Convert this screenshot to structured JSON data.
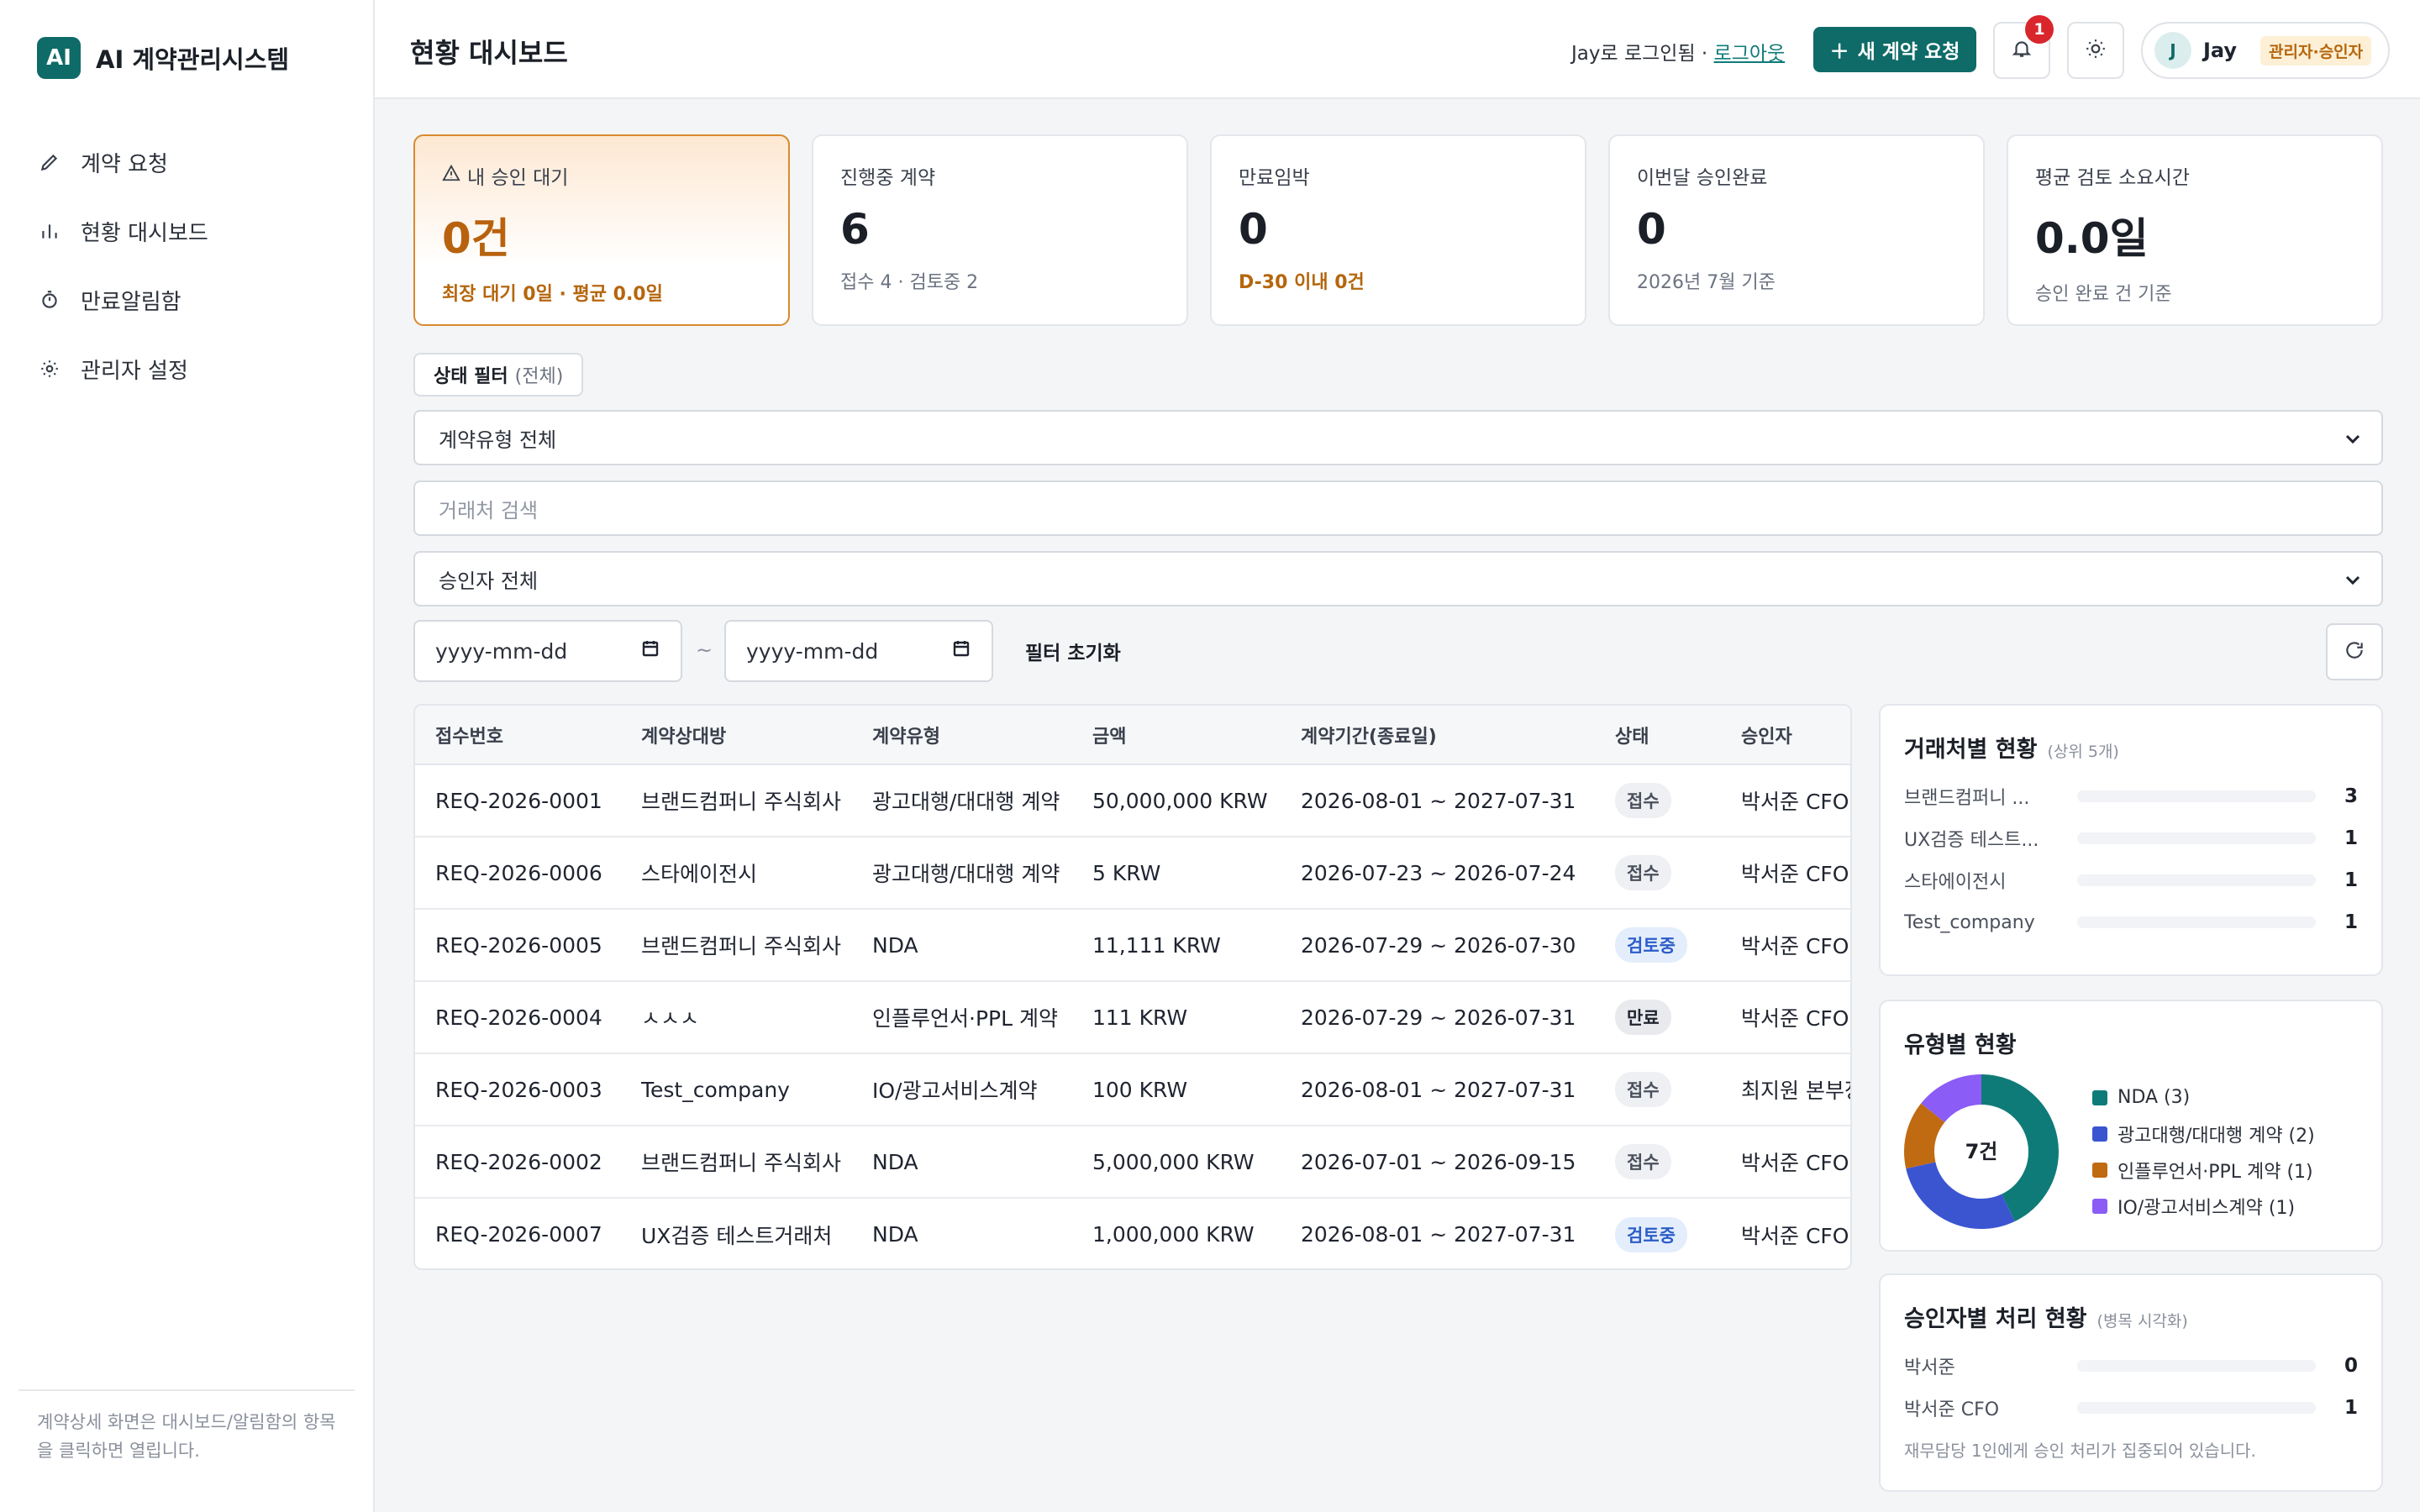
{
  "brand": {
    "logo": "AI",
    "name": "AI 계약관리시스템"
  },
  "nav": [
    {
      "label": "계약 요청",
      "icon": "pencil-icon"
    },
    {
      "label": "현황 대시보드",
      "icon": "bar-chart-icon"
    },
    {
      "label": "만료알림함",
      "icon": "stopwatch-icon"
    },
    {
      "label": "관리자 설정",
      "icon": "gear-icon"
    }
  ],
  "sidebar_footer": "계약상세 화면은 대시보드/알림함의 항목을 클릭하면 열립니다.",
  "header": {
    "title": "현황 대시보드",
    "login_text": "Jay로 로그인됨 · ",
    "logout_label": "로그아웃",
    "new_request_label": "새 계약 요청",
    "notification_count": "1",
    "user": {
      "initial": "J",
      "name": "Jay",
      "role": "관리자·승인자"
    }
  },
  "kpis": [
    {
      "label": "내 승인 대기",
      "value": "0건",
      "sub": "최장 대기 0일 · 평균 0.0일"
    },
    {
      "label": "진행중 계약",
      "value": "6",
      "sub": "접수 4 · 검토중 2"
    },
    {
      "label": "만료임박",
      "value": "0",
      "sub": "D-30 이내 0건"
    },
    {
      "label": "이번달 승인완료",
      "value": "0",
      "sub": "2026년 7월 기준"
    },
    {
      "label": "평균 검토 소요시간",
      "value": "0.0일",
      "sub": "승인 완료 건 기준"
    }
  ],
  "filters": {
    "status_chip_label": "상태 필터",
    "status_chip_value": "(전체)",
    "contract_type": "계약유형 전체",
    "partner_placeholder": "거래처 검색",
    "approver": "승인자 전체",
    "date_from_placeholder": "yyyy-mm-dd",
    "date_to_placeholder": "yyyy-mm-dd",
    "date_separator": "~",
    "reset_label": "필터 초기화"
  },
  "table": {
    "columns": [
      "접수번호",
      "계약상대방",
      "계약유형",
      "금액",
      "계약기간(종료일)",
      "상태",
      "승인자"
    ],
    "rows": [
      {
        "id": "REQ-2026-0001",
        "party": "브랜드컴퍼니 주식회사",
        "type": "광고대행/대대행 계약",
        "amount": "50,000,000 KRW",
        "period": "2026-08-01 ~ 2027-07-31",
        "status": "접수",
        "approver": "박서준 CFO"
      },
      {
        "id": "REQ-2026-0006",
        "party": "스타에이전시",
        "type": "광고대행/대대행 계약",
        "amount": "5 KRW",
        "period": "2026-07-23 ~ 2026-07-24",
        "status": "접수",
        "approver": "박서준 CFO"
      },
      {
        "id": "REQ-2026-0005",
        "party": "브랜드컴퍼니 주식회사",
        "type": "NDA",
        "amount": "11,111 KRW",
        "period": "2026-07-29 ~ 2026-07-30",
        "status": "검토중",
        "approver": "박서준 CFO"
      },
      {
        "id": "REQ-2026-0004",
        "party": "ㅅㅅㅅ",
        "type": "인플루언서·PPL 계약",
        "amount": "111 KRW",
        "period": "2026-07-29 ~ 2026-07-31",
        "status": "만료",
        "approver": "박서준 CFO"
      },
      {
        "id": "REQ-2026-0003",
        "party": "Test_company",
        "type": "IO/광고서비스계약",
        "amount": "100 KRW",
        "period": "2026-08-01 ~ 2027-07-31",
        "status": "접수",
        "approver": "최지원 본부장"
      },
      {
        "id": "REQ-2026-0002",
        "party": "브랜드컴퍼니 주식회사",
        "type": "NDA",
        "amount": "5,000,000 KRW",
        "period": "2026-07-01 ~ 2026-09-15",
        "status": "접수",
        "approver": "박서준 CFO"
      },
      {
        "id": "REQ-2026-0007",
        "party": "UX검증 테스트거래처",
        "type": "NDA",
        "amount": "1,000,000 KRW",
        "period": "2026-08-01 ~ 2027-07-31",
        "status": "검토중",
        "approver": "박서준 CFO"
      }
    ]
  },
  "partner_panel": {
    "title": "거래처별 현황",
    "subtitle": "(상위 5개)",
    "items": [
      {
        "label": "브랜드컴퍼니 ...",
        "value": 3
      },
      {
        "label": "UX검증 테스트...",
        "value": 1
      },
      {
        "label": "스타에이전시",
        "value": 1
      },
      {
        "label": "Test_company",
        "value": 1
      }
    ]
  },
  "type_panel": {
    "title": "유형별 현황",
    "center_label": "7건",
    "slices": [
      {
        "label": "NDA (3)",
        "value": 3,
        "color": "#0f7b78"
      },
      {
        "label": "광고대행/대대행 계약 (2)",
        "value": 2,
        "color": "#3b55d1"
      },
      {
        "label": "인플루언서·PPL 계약 (1)",
        "value": 1,
        "color": "#c06a12"
      },
      {
        "label": "IO/광고서비스계약 (1)",
        "value": 1,
        "color": "#8b5cf6"
      }
    ]
  },
  "approver_panel": {
    "title": "승인자별 처리 현황",
    "subtitle": "(병목 시각화)",
    "items": [
      {
        "label": "박서준",
        "value": 0
      },
      {
        "label": "박서준 CFO",
        "value": 1
      }
    ],
    "note": "재무담당 1인에게 승인 처리가 집중되어 있습니다."
  },
  "colors": {
    "primary": "#0f6b68",
    "warning": "#b5660c",
    "danger": "#d9262c"
  }
}
